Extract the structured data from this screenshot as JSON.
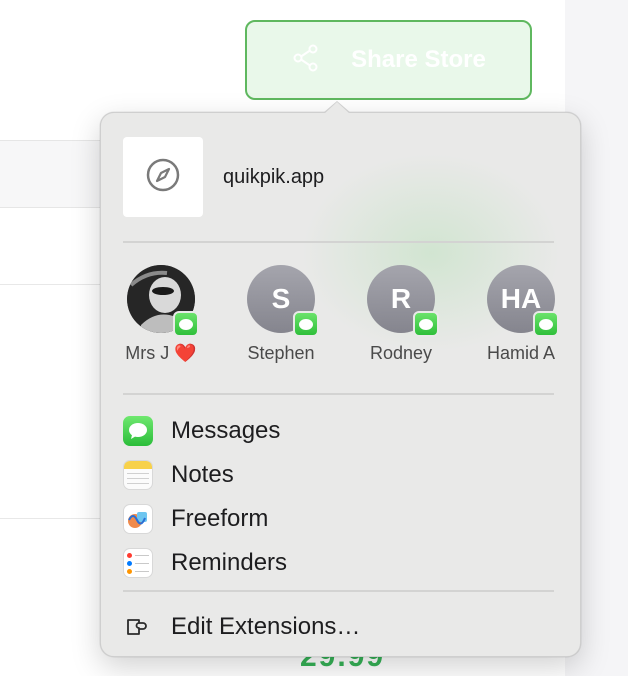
{
  "share_button": {
    "label": "Share Store",
    "icon": "share-nodes-icon"
  },
  "background": {
    "price_text": "29.99"
  },
  "popover": {
    "site": {
      "title": "quikpik.app",
      "icon": "compass-icon"
    },
    "people": [
      {
        "name": "Mrs J ❤️",
        "initials": "",
        "avatar": "photo",
        "badge": "messages-badge-icon"
      },
      {
        "name": "Stephen",
        "initials": "S",
        "avatar": "initials",
        "badge": "messages-badge-icon"
      },
      {
        "name": "Rodney",
        "initials": "R",
        "avatar": "initials",
        "badge": "messages-badge-icon"
      },
      {
        "name": "Hamid A",
        "initials": "HA",
        "avatar": "initials",
        "badge": "messages-badge-icon"
      }
    ],
    "apps": [
      {
        "label": "Messages",
        "icon": "messages-app-icon"
      },
      {
        "label": "Notes",
        "icon": "notes-app-icon"
      },
      {
        "label": "Freeform",
        "icon": "freeform-app-icon"
      },
      {
        "label": "Reminders",
        "icon": "reminders-app-icon"
      }
    ],
    "edit_extensions": {
      "label": "Edit Extensions…",
      "icon": "extensions-icon"
    }
  },
  "colors": {
    "share_border": "#5fb85f",
    "share_fill": "#e9f8ea",
    "popover_bg": "#e9e9e8",
    "messages_green": "#34c759"
  }
}
